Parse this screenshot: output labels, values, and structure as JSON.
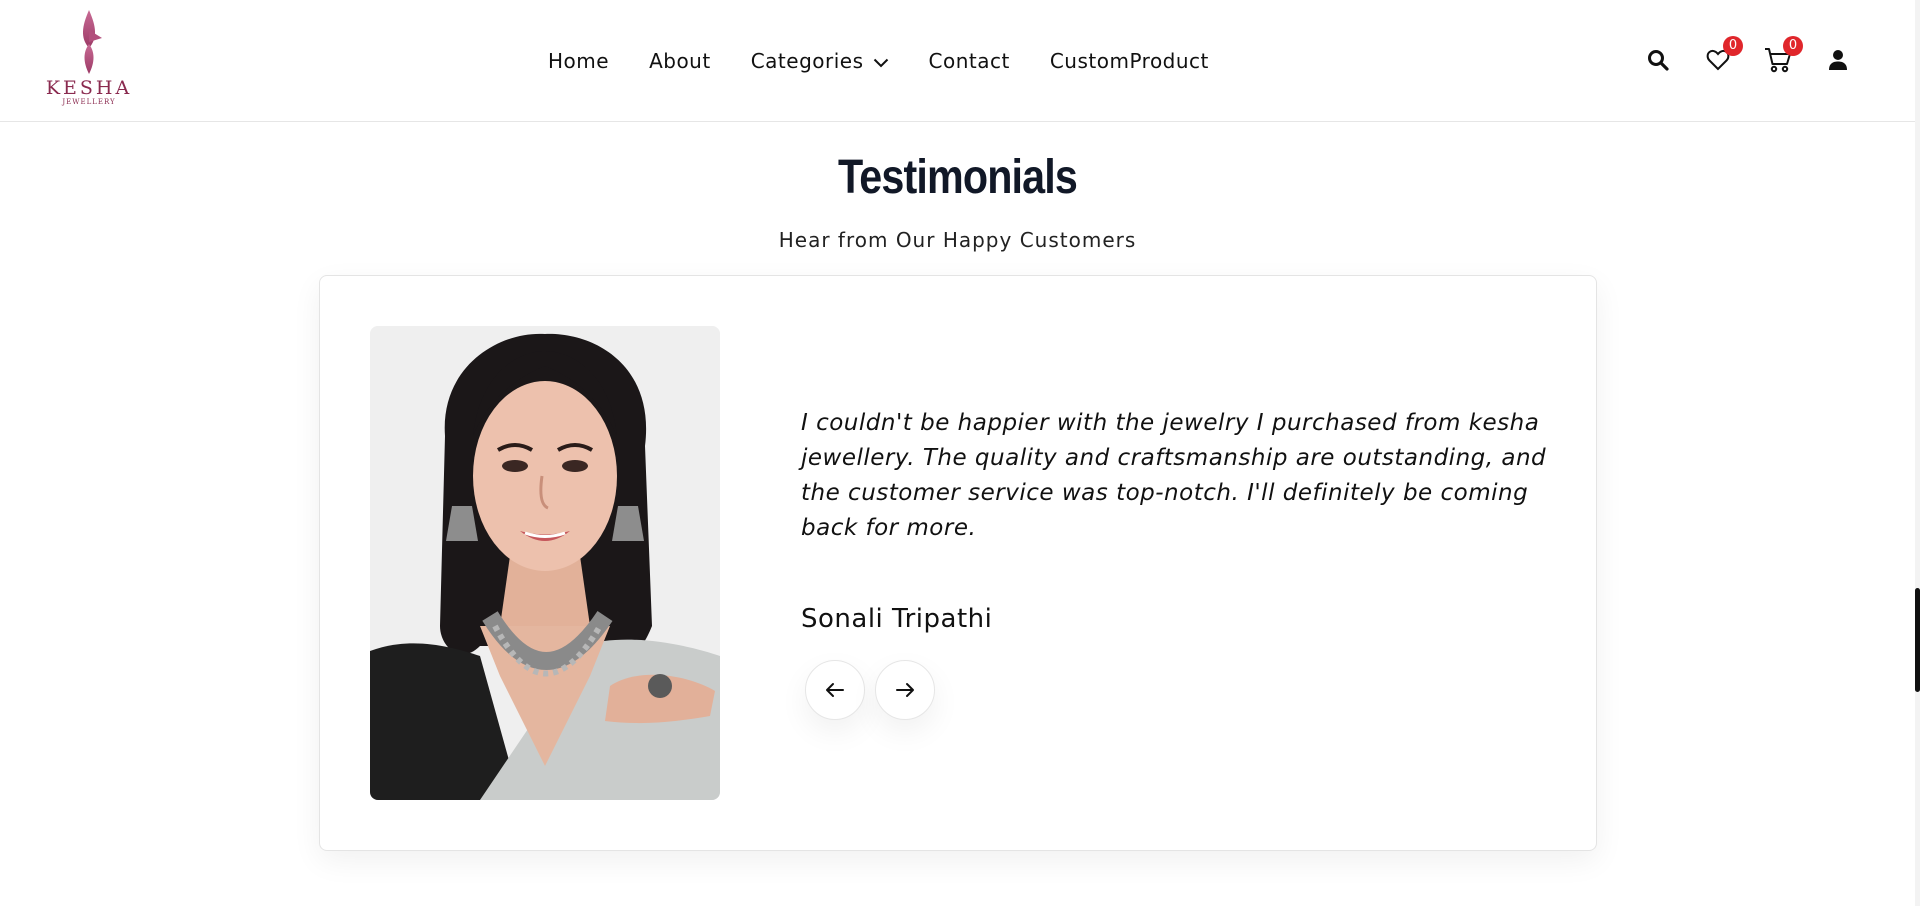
{
  "header": {
    "logo": {
      "word": "KESHA",
      "sub": "JEWELLERY"
    },
    "nav": [
      {
        "label": "Home"
      },
      {
        "label": "About"
      },
      {
        "label": "Categories"
      },
      {
        "label": "Contact"
      },
      {
        "label": "CustomProduct"
      }
    ],
    "icons": {
      "search": "search-icon",
      "wishlist": "heart-icon",
      "cart": "cart-icon",
      "account": "user-icon"
    },
    "wishlist_count": "0",
    "cart_count": "0"
  },
  "section": {
    "title": "Testimonials",
    "subtitle": "Hear from Our Happy Customers"
  },
  "testimonial": {
    "quote": "I couldn't be happier with the jewelry I purchased from kesha jewellery. The quality and craftsmanship are outstanding, and the customer service was top-notch. I'll definitely be coming back for more.",
    "name": "Sonali Tripathi"
  },
  "colors": {
    "brand": "#8a2a4f",
    "badge": "#e0262b",
    "title": "#111827"
  }
}
